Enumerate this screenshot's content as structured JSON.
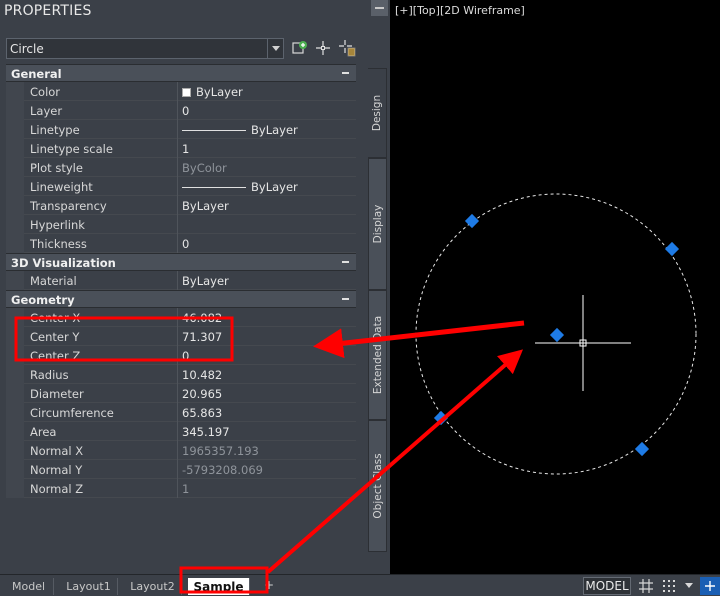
{
  "palette": {
    "title": "PROPERTIES",
    "selected_object": "Circle",
    "sections": [
      {
        "label": "General",
        "rows": [
          {
            "label": "Color",
            "value": "ByLayer",
            "kind": "swatch"
          },
          {
            "label": "Layer",
            "value": "0"
          },
          {
            "label": "Linetype",
            "value": "ByLayer",
            "kind": "line"
          },
          {
            "label": "Linetype scale",
            "value": "1"
          },
          {
            "label": "Plot style",
            "value": "ByColor",
            "dim": true
          },
          {
            "label": "Lineweight",
            "value": "ByLayer",
            "kind": "line"
          },
          {
            "label": "Transparency",
            "value": "ByLayer"
          },
          {
            "label": "Hyperlink",
            "value": ""
          },
          {
            "label": "Thickness",
            "value": "0"
          }
        ]
      },
      {
        "label": "3D Visualization",
        "rows": [
          {
            "label": "Material",
            "value": "ByLayer"
          }
        ]
      },
      {
        "label": "Geometry",
        "rows": [
          {
            "label": "Center X",
            "value": "46.082"
          },
          {
            "label": "Center Y",
            "value": "71.307"
          },
          {
            "label": "Center Z",
            "value": "0"
          },
          {
            "label": "Radius",
            "value": "10.482"
          },
          {
            "label": "Diameter",
            "value": "20.965"
          },
          {
            "label": "Circumference",
            "value": "65.863"
          },
          {
            "label": "Area",
            "value": "345.197"
          },
          {
            "label": "Normal X",
            "value": "1965357.193",
            "dim": true
          },
          {
            "label": "Normal Y",
            "value": "-5793208.069",
            "dim": true
          },
          {
            "label": "Normal Z",
            "value": "1",
            "dim": true
          }
        ]
      }
    ],
    "side_tabs": [
      "Design",
      "Display",
      "Extended Data",
      "Object Class"
    ]
  },
  "viewport": {
    "label": "[+][Top][2D Wireframe]"
  },
  "bottom": {
    "layout_tabs": [
      "Model",
      "Layout1",
      "Layout2",
      "Sample"
    ],
    "active_tab": "Sample",
    "add_tab": "+",
    "model_button": "MODEL"
  },
  "colors": {
    "annotation": "#ff0000",
    "grip": "#1e7be6",
    "palette_bg": "#3b4048"
  }
}
